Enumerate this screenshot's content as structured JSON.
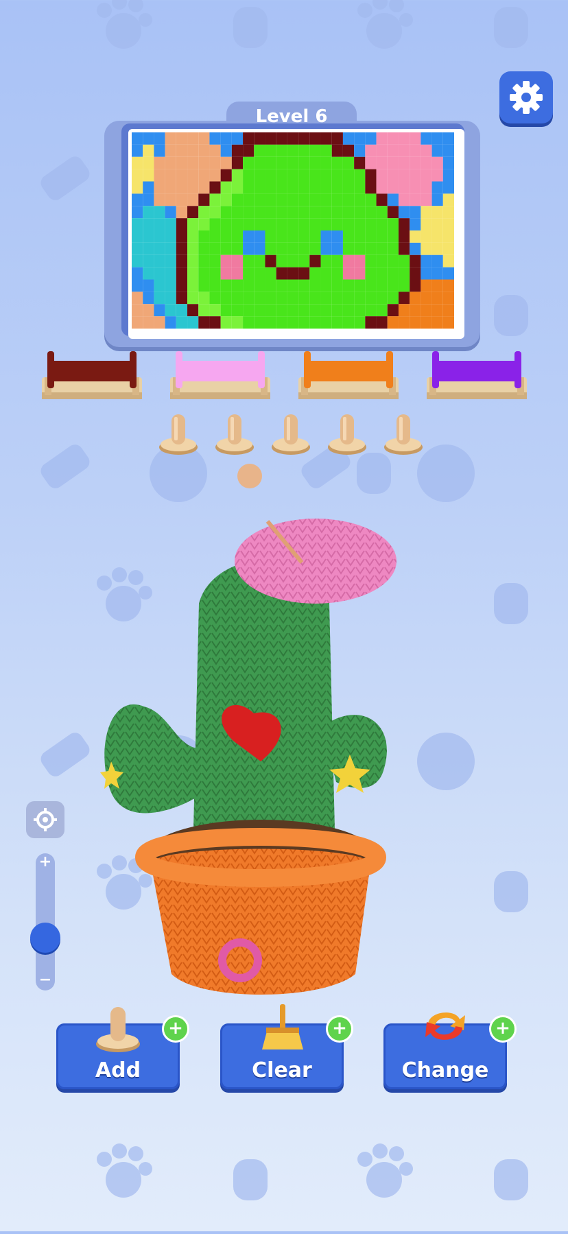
{
  "level_label": "Level 6",
  "settings_icon": "gear-icon",
  "spools": [
    {
      "color": "#7a1a12",
      "name": "dark-red"
    },
    {
      "color": "#f6a7f0",
      "name": "pink"
    },
    {
      "color": "#f07f1b",
      "name": "orange"
    },
    {
      "color": "#8a22e8",
      "name": "purple"
    }
  ],
  "pegs_count": 5,
  "zoom": {
    "plus": "+",
    "minus": "−",
    "level": 0.35
  },
  "buttons": {
    "add": {
      "label": "Add",
      "icon": "peg-icon"
    },
    "clear": {
      "label": "Clear",
      "icon": "broom-icon"
    },
    "change": {
      "label": "Change",
      "icon": "swap-arrows-icon"
    }
  },
  "pixel_palette": {
    "B": "#2f8ef0",
    "C": "#2bc6d0",
    "S": "#f0a777",
    "P": "#f78fb3",
    "Y": "#f6e46a",
    "O": "#f07f1b",
    "D": "#6b0f13",
    "G": "#49e51b",
    "L": "#7bf23a",
    "E": "#2f8ef0",
    "K": "#f07aa0"
  },
  "pixel_rows": [
    "BBBSSSSBBBDDDDDDDDDBBBPPPPBBB",
    "BYBSSSSSBDDGGGGGGGDDBPPPPPPBB",
    "YYSSSSSSSDGGGGGGGGGGDPPPPPPPB",
    "YYSSSSSSDLGGGGGGGGGGGDPPPPPPB",
    "YBSSSSSDLLGGGGGGGGGGGDPPPPPBB",
    "BBSSSSDLLGGGGGGGGGGGGGDBPPPBY",
    "BCCBSDLLGGGGGGGGGGGGGGGDBBYYY",
    "CCCCDLLGGGGGGGGGGGGGGGGGDBYYY",
    "CCCCDLGGGGEEGGGGGEEGGGGGDYYYY",
    "CCCCDLGGGGEEGGGGGEEGGGGGDBYYY",
    "CCCCDLGGKKGGDGGGDGGKKGGGGDBBY",
    "BCCCDLGGKKGGGDDDGGGKKGGGGDBBB",
    "BBCCDLGGGGGGGGGGGGGGGGGGGDOOO",
    "SBCCDLLGGGGGGGGGGGGGGGGGDOOOO",
    "SSBCCDLLGGGGGGGGGGGGGGGDOOOOO",
    "SSSBCCDDLLGGGGGGGGGGGDDOOOOOO"
  ]
}
